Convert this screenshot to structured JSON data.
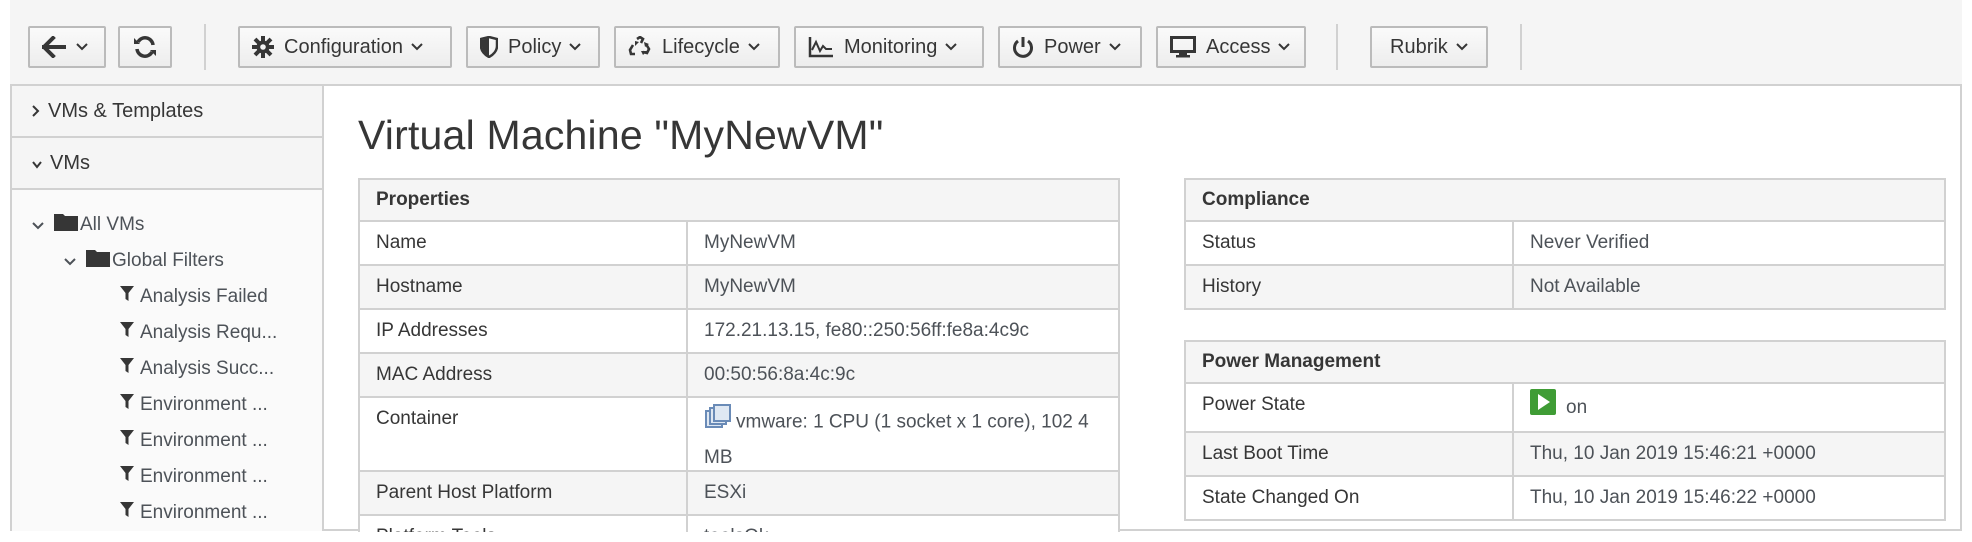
{
  "toolbar": {
    "back_title": "Back",
    "reload_title": "Reload",
    "configuration": "Configuration",
    "policy": "Policy",
    "lifecycle": "Lifecycle",
    "monitoring": "Monitoring",
    "power": "Power",
    "access": "Access",
    "rubrik": "Rubrik"
  },
  "sidebar": {
    "accordion_templates": "VMs & Templates",
    "accordion_vms": "VMs",
    "tree": {
      "all_vms": "All VMs",
      "global_filters": "Global Filters",
      "filters": [
        "Analysis Failed",
        "Analysis Requ...",
        "Analysis Succ...",
        "Environment ...",
        "Environment ...",
        "Environment ...",
        "Environment ..."
      ]
    }
  },
  "main": {
    "title": "Virtual Machine \"MyNewVM\"",
    "properties": {
      "heading": "Properties",
      "rows": [
        {
          "key": "Name",
          "value": "MyNewVM"
        },
        {
          "key": "Hostname",
          "value": "MyNewVM"
        },
        {
          "key": "IP Addresses",
          "value": "172.21.13.15, fe80::250:56ff:fe8a:4c9c"
        },
        {
          "key": "MAC Address",
          "value": "00:50:56:8a:4c:9c"
        },
        {
          "key": "Container",
          "value": "vmware: 1 CPU (1 socket x 1 core), 102 4 MB"
        },
        {
          "key": "Parent Host Platform",
          "value": "ESXi"
        },
        {
          "key": "Platform Tools",
          "value": "toolsOk"
        }
      ]
    },
    "compliance": {
      "heading": "Compliance",
      "rows": [
        {
          "key": "Status",
          "value": "Never Verified"
        },
        {
          "key": "History",
          "value": "Not Available"
        }
      ]
    },
    "power_management": {
      "heading": "Power Management",
      "rows": [
        {
          "key": "Power State",
          "value": "on"
        },
        {
          "key": "Last Boot Time",
          "value": "Thu, 10 Jan 2019 15:46:21 +0000"
        },
        {
          "key": "State Changed On",
          "value": "Thu, 10 Jan 2019 15:46:22 +0000"
        }
      ]
    }
  },
  "colors": {
    "power_on": "#3f9c35",
    "border": "#d1d1d1",
    "header_bg": "#f5f5f5"
  }
}
